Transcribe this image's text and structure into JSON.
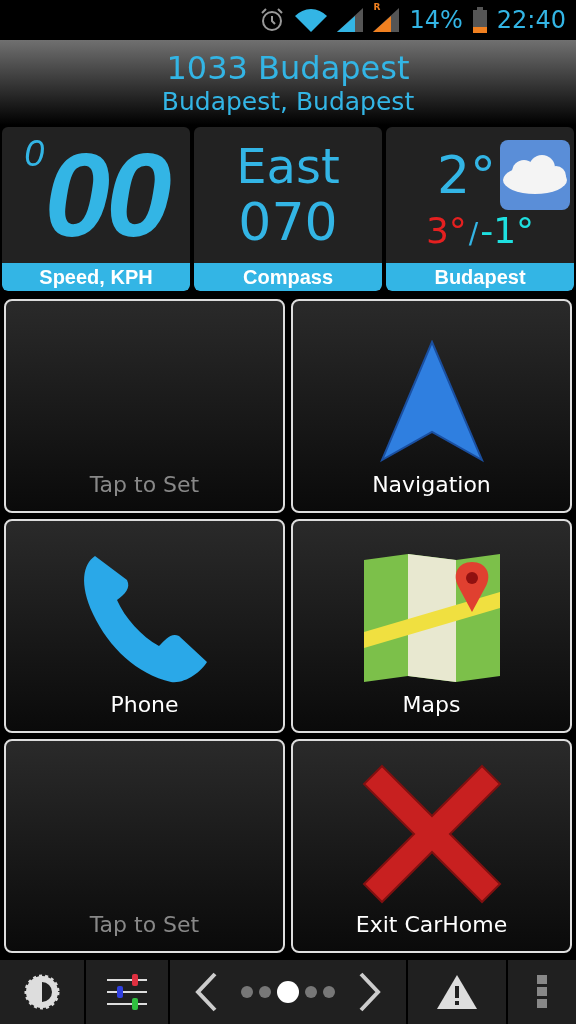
{
  "status_bar": {
    "roaming_mark": "R",
    "battery_text": "14%",
    "time": "22:40"
  },
  "header": {
    "title": "1033 Budapest",
    "subtitle": "Budapest, Budapest"
  },
  "widgets": [
    {
      "kind": "speed",
      "prefix": "0",
      "value": "00",
      "label": "Speed, KPH"
    },
    {
      "kind": "compass",
      "direction": "East",
      "heading": "070",
      "label": "Compass"
    },
    {
      "kind": "weather",
      "temp": "2°",
      "high": "3°",
      "separator": "/",
      "low": "-1°",
      "label": "Budapest"
    }
  ],
  "tiles": [
    {
      "kind": "empty",
      "label": "Tap to Set"
    },
    {
      "kind": "navigation",
      "label": "Navigation"
    },
    {
      "kind": "phone",
      "label": "Phone"
    },
    {
      "kind": "maps",
      "label": "Maps"
    },
    {
      "kind": "empty",
      "label": "Tap to Set"
    },
    {
      "kind": "exit",
      "label": "Exit CarHome"
    }
  ],
  "pages": [
    {
      "selected": false
    },
    {
      "selected": false
    },
    {
      "selected": true
    },
    {
      "selected": false
    },
    {
      "selected": false
    }
  ]
}
